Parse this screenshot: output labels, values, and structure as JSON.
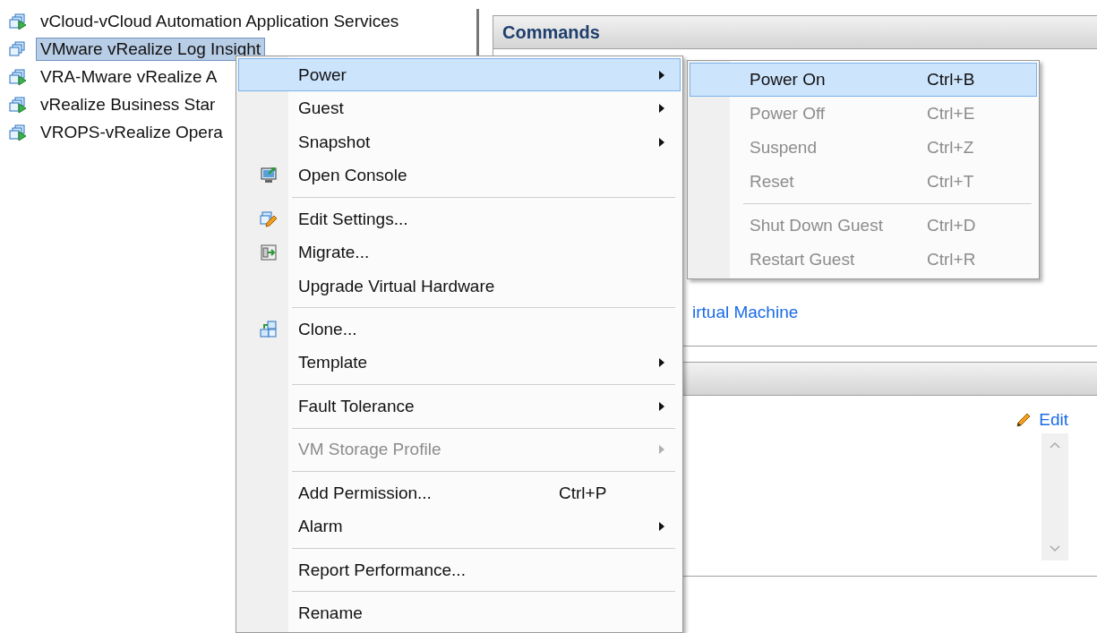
{
  "tree": {
    "items": [
      {
        "label": "vCloud-vCloud Automation Application Services",
        "selected": false,
        "powered_on": true
      },
      {
        "label": "VMware vRealize Log Insight",
        "selected": true,
        "powered_on": false
      },
      {
        "label": "VRA-Mware vRealize A",
        "selected": false,
        "powered_on": true
      },
      {
        "label": "vRealize Business Star",
        "selected": false,
        "powered_on": true
      },
      {
        "label": "VROPS-vRealize Opera",
        "selected": false,
        "powered_on": true
      }
    ]
  },
  "commands_panel": {
    "title": "Commands",
    "link": "irtual Machine"
  },
  "details_panel": {
    "edit_link": "Edit"
  },
  "context_menu": {
    "items": [
      {
        "kind": "item",
        "label": "Power",
        "submenu": true,
        "disabled": false,
        "selected": true
      },
      {
        "kind": "item",
        "label": "Guest",
        "submenu": true,
        "disabled": false,
        "selected": false
      },
      {
        "kind": "item",
        "label": "Snapshot",
        "submenu": true,
        "disabled": false,
        "selected": false
      },
      {
        "kind": "console",
        "label": "Open Console",
        "submenu": false,
        "disabled": false,
        "selected": false
      },
      {
        "kind": "separator"
      },
      {
        "kind": "settings",
        "label": "Edit Settings...",
        "submenu": false,
        "disabled": false,
        "selected": false
      },
      {
        "kind": "migrate",
        "label": "Migrate...",
        "submenu": false,
        "disabled": false,
        "selected": false
      },
      {
        "kind": "item",
        "label": "Upgrade Virtual Hardware",
        "submenu": false,
        "disabled": false,
        "selected": false
      },
      {
        "kind": "separator"
      },
      {
        "kind": "clone",
        "label": "Clone...",
        "submenu": false,
        "disabled": false,
        "selected": false
      },
      {
        "kind": "item",
        "label": "Template",
        "submenu": true,
        "disabled": false,
        "selected": false
      },
      {
        "kind": "separator"
      },
      {
        "kind": "item",
        "label": "Fault Tolerance",
        "submenu": true,
        "disabled": false,
        "selected": false
      },
      {
        "kind": "separator"
      },
      {
        "kind": "item",
        "label": "VM Storage Profile",
        "submenu": true,
        "disabled": true,
        "selected": false
      },
      {
        "kind": "separator"
      },
      {
        "kind": "item",
        "label": "Add Permission...",
        "shortcut": "Ctrl+P",
        "submenu": false,
        "disabled": false,
        "selected": false
      },
      {
        "kind": "item",
        "label": "Alarm",
        "submenu": true,
        "disabled": false,
        "selected": false
      },
      {
        "kind": "separator"
      },
      {
        "kind": "item",
        "label": "Report Performance...",
        "submenu": false,
        "disabled": false,
        "selected": false
      },
      {
        "kind": "separator"
      },
      {
        "kind": "item",
        "label": "Rename",
        "submenu": false,
        "disabled": false,
        "selected": false
      }
    ]
  },
  "power_submenu": {
    "items": [
      {
        "kind": "item",
        "label": "Power On",
        "shortcut": "Ctrl+B",
        "disabled": false,
        "selected": true
      },
      {
        "kind": "item",
        "label": "Power Off",
        "shortcut": "Ctrl+E",
        "disabled": true,
        "selected": false
      },
      {
        "kind": "item",
        "label": "Suspend",
        "shortcut": "Ctrl+Z",
        "disabled": true,
        "selected": false
      },
      {
        "kind": "item",
        "label": "Reset",
        "shortcut": "Ctrl+T",
        "disabled": true,
        "selected": false
      },
      {
        "kind": "separator"
      },
      {
        "kind": "item",
        "label": "Shut Down Guest",
        "shortcut": "Ctrl+D",
        "disabled": true,
        "selected": false
      },
      {
        "kind": "item",
        "label": "Restart Guest",
        "shortcut": "Ctrl+R",
        "disabled": true,
        "selected": false
      }
    ]
  }
}
